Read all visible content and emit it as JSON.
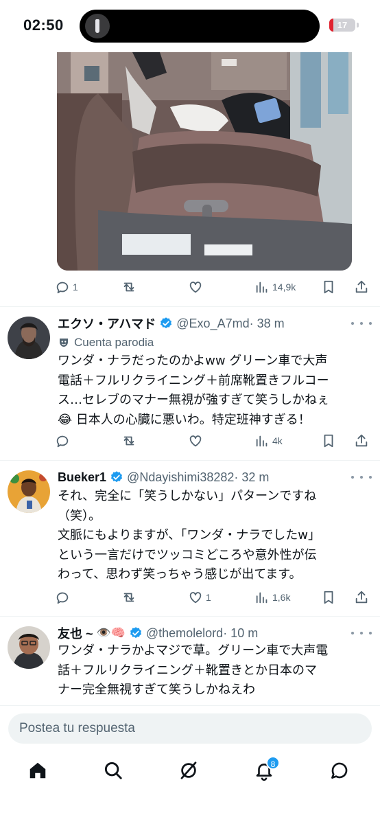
{
  "status_bar": {
    "time": "02:50",
    "battery_level": "17",
    "battery_fraction": 0.17,
    "battery_color": "#e0222f"
  },
  "top_post": {
    "actions": {
      "replies": "1",
      "retweets": "",
      "likes": "",
      "views": "14,9k"
    }
  },
  "replies": [
    {
      "name": "エクソ・アハマド",
      "handle": "@Exo_A7md",
      "time": "· 38 m",
      "label": "Cuenta parodia",
      "text": "ワンダ・ナラだったのかよww グリーン車で大声\n電話＋フルリクライニング＋前席靴置きフルコー\nス…セレブのマナー無視が強すぎて笑うしかねぇ\n",
      "text_tail": "日本人の心臓に悪いわ。特定班神すぎる！",
      "emoji": "😂",
      "actions": {
        "replies": "",
        "retweets": "",
        "likes": "",
        "views": "4k"
      }
    },
    {
      "name": "Bueker1",
      "handle": "@Ndayishimi38282",
      "time": "· 32 m",
      "text": "それ、完全に「笑うしかない」パターンですね\n（笑）。\n文脈にもよりますが、「ワンダ・ナラでしたw」\nという一言だけでツッコミどころや意外性が伝\nわって、思わず笑っちゃう感じが出てます。",
      "actions": {
        "replies": "",
        "retweets": "",
        "likes": "1",
        "views": "1,6k"
      }
    },
    {
      "name": "友也 ~",
      "name_emojis": "👁️🧠",
      "handle": "@themolelord",
      "time": "· 10 m",
      "text": "ワンダ・ナラかよマジで草。グリーン車で大声電\n話＋フルリクライニング＋靴置きとか日本のマ\nナー完全無視すぎて笑うしかねえわ"
    }
  ],
  "reply_bar": {
    "placeholder": "Postea tu respuesta"
  },
  "tab_bar": {
    "items": [
      "home-icon",
      "search-icon",
      "grok-icon",
      "notifications-icon",
      "messages-icon"
    ],
    "notification_count": "8"
  },
  "colors": {
    "accent": "#1d9bf0",
    "secondary_text": "#536471",
    "divider": "#eff3f4"
  }
}
